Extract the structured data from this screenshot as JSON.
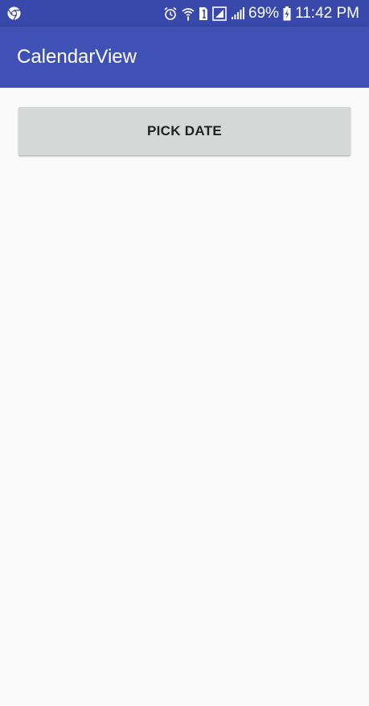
{
  "status_bar": {
    "battery_percent": "69%",
    "time": "11:42 PM",
    "icons": [
      "chrome-icon",
      "alarm-icon",
      "wifi-icon",
      "sim-1-icon",
      "screen-signal-icon",
      "cell-signal-icon",
      "battery-charging-icon"
    ]
  },
  "app_bar": {
    "title": "CalendarView"
  },
  "main": {
    "pick_date_label": "PICK DATE"
  },
  "colors": {
    "status_bar": "#3949ab",
    "app_bar": "#3f51b5",
    "background": "#fafafa",
    "button": "#d6d7d7",
    "button_text": "#212121"
  }
}
